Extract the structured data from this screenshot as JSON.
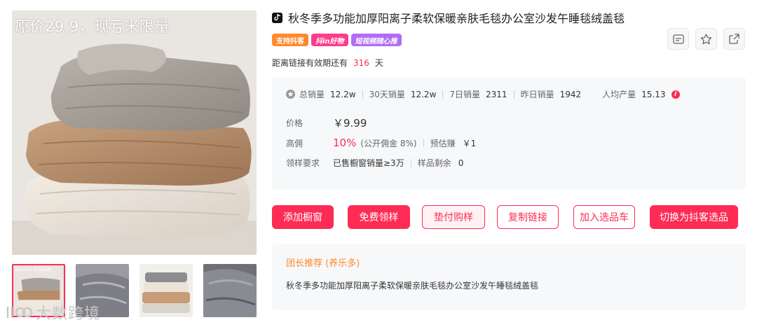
{
  "gallery": {
    "overlay_text": "原价29.9，现亏米限量",
    "thumb_tiny_text": "原价29.9，现亏米限量",
    "watermark_text": "大数跨境"
  },
  "product": {
    "title": "秋冬季多功能加厚阳离子柔软保暖亲肤毛毯办公室沙发午睡毯绒盖毯",
    "tags": [
      "支持抖客",
      "抖in好物",
      "短视频随心推"
    ]
  },
  "validity": {
    "prefix": "距离链接有效期还有",
    "days": "316",
    "suffix": "天"
  },
  "stats": {
    "total_sales_label": "总销量",
    "total_sales": "12.2w",
    "sales_30d_label": "30天销量",
    "sales_30d": "12.2w",
    "sales_7d_label": "7日销量",
    "sales_7d": "2311",
    "sales_yesterday_label": "昨日销量",
    "sales_yesterday": "1942",
    "per_capita_label": "人均产量",
    "per_capita": "15.13",
    "info_mark": "i"
  },
  "pricing": {
    "price_label": "价格",
    "price": "￥9.99",
    "commission_label": "高佣",
    "commission_rate": "10%",
    "public_commission": "(公开佣金 8%)",
    "estimated_label": "预估赚",
    "estimated": "￥1",
    "sample_label": "领样要求",
    "sample_requirement": "已售橱窗销量≥3万",
    "remaining_label": "样品剩余",
    "remaining": "0"
  },
  "actions": {
    "add_showcase": "添加橱窗",
    "free_sample": "免费领样",
    "advance_buy": "垫付购样",
    "copy_link": "复制链接",
    "add_cart": "加入选品车",
    "switch_doukee": "切换为抖客选品"
  },
  "recommend": {
    "title": "团长推荐 (养乐多)",
    "text": "秋冬季多功能加厚阳离子柔软保暖亲肤毛毯办公室沙发午睡毯绒盖毯"
  },
  "colors": {
    "accent": "#fe2c55",
    "orange": "#fe8a2e",
    "purple": "#b06cf6",
    "pink": "#fe3d8a"
  },
  "icons": [
    "tiktok-icon",
    "card-icon",
    "star-icon",
    "share-icon",
    "sales-star-icon",
    "info-icon",
    "watermark-logo-icon"
  ]
}
